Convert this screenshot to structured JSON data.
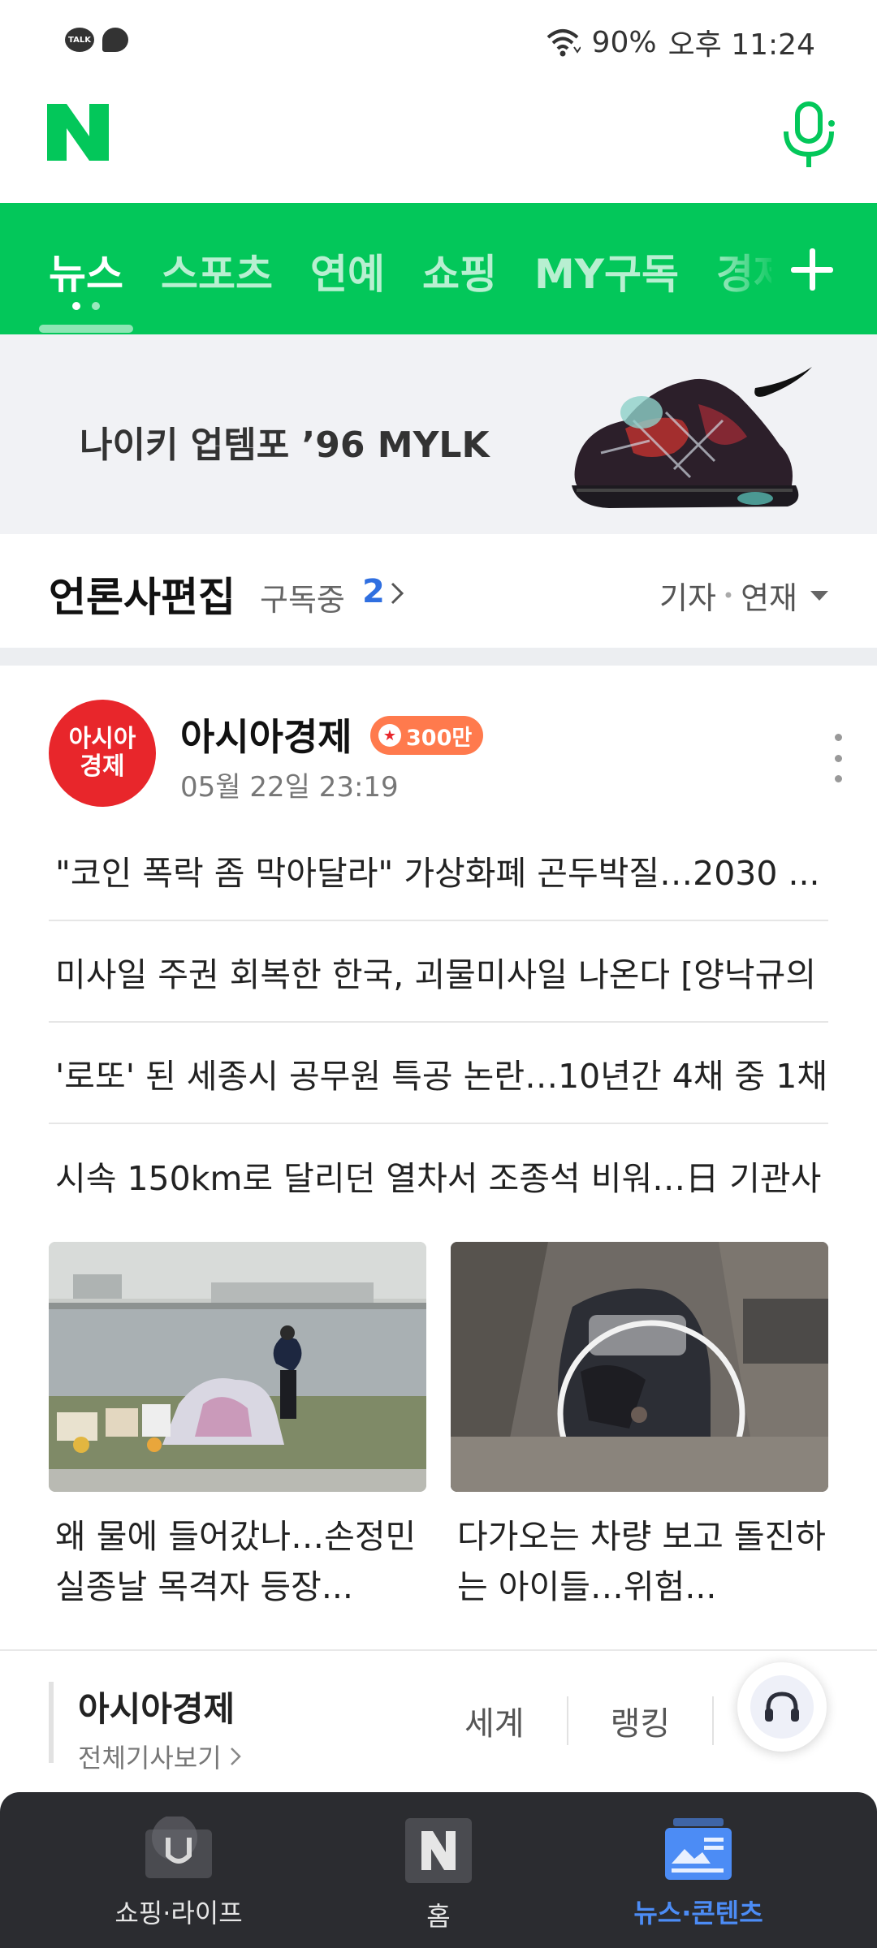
{
  "status_bar": {
    "talk_icon_text": "TALK",
    "battery": "90%",
    "time": "오후 11:24"
  },
  "header": {
    "logo_text": "N",
    "brand_color": "#03c75a"
  },
  "tabs": [
    {
      "label": "뉴스",
      "active": true
    },
    {
      "label": "스포츠",
      "active": false
    },
    {
      "label": "연예",
      "active": false
    },
    {
      "label": "쇼핑",
      "active": false
    },
    {
      "label": "MY구독",
      "active": false
    },
    {
      "label": "경제",
      "active": false
    }
  ],
  "ad": {
    "text": "나이키 업템포 ’96 MYLK"
  },
  "press_section": {
    "title": "언론사편집",
    "subscribing_label": "구독중",
    "subscribing_count": "2",
    "filter_reporter": "기자",
    "filter_series": "연재"
  },
  "publisher": {
    "name": "아시아경제",
    "avatar_line1": "아시아",
    "avatar_line2": "경제",
    "badge": "300만",
    "datetime": "05월 22일 23:19",
    "headlines": [
      "\"코인 폭락 좀 막아달라\" 가상화폐 곤두박질…2030 ...",
      "미사일 주권 회복한 한국, 괴물미사일 나온다 [양낙규의 ...",
      "'로또' 된 세종시 공무원 특공 논란…10년간 4채 중 1채 ...",
      "시속 150km로 달리던 열차서 조종석 비워…日 기관사 ..."
    ],
    "photo_news": [
      {
        "caption": "왜 물에 들어갔나…손정민 실종날 목격자 등장..."
      },
      {
        "caption": "다가오는 차량 보고 돌진하는 아이들…위험..."
      }
    ]
  },
  "footer_pub": {
    "name": "아시아경제",
    "view_all": "전체기사보기",
    "links": [
      "세계",
      "랭킹"
    ]
  },
  "bottom_nav": [
    {
      "label": "쇼핑·라이프",
      "icon": "shopping-bag-icon",
      "active": false
    },
    {
      "label": "홈",
      "icon": "naver-home-icon",
      "active": false
    },
    {
      "label": "뉴스·콘텐츠",
      "icon": "news-content-icon",
      "active": true
    }
  ],
  "colors": {
    "brand_green": "#03c75a",
    "accent_blue": "#4c8cf5",
    "publisher_red": "#e8262b",
    "badge_orange": "#ff7a4d"
  }
}
